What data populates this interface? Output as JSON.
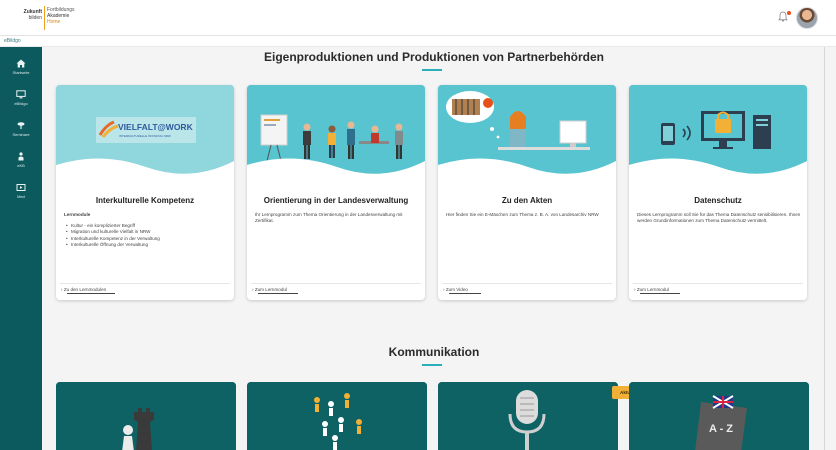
{
  "header": {
    "logo_line1": "Zukunft",
    "logo_line2": "bilden",
    "brand_line1": "Fortbildungs",
    "brand_line2": "Akademie",
    "brand_line3": "Home",
    "substrip_text": "eBildgo"
  },
  "sidebar": {
    "items": [
      {
        "label": "Startseite",
        "icon": "home-icon"
      },
      {
        "label": "eBildgo",
        "icon": "monitor-icon"
      },
      {
        "label": "Seminare",
        "icon": "presentation-icon"
      },
      {
        "label": "eKB",
        "icon": "person-icon"
      },
      {
        "label": "Med",
        "icon": "media-icon"
      }
    ]
  },
  "sections": {
    "eigen_title": "Eigenproduktionen und Produktionen von Partnerbehörden",
    "kommunikation_title": "Kommunikation"
  },
  "cards": [
    {
      "title": "Interkulturelle Kompetenz",
      "image_text": "VIELFALT@WORK",
      "image_subtext": "INTERKULTURELLE ÖFFNUNG NRW",
      "heading": "Lernmodule",
      "bullets": [
        "Kultur - ein komplizierter Begriff",
        "Migration und kulturelle Vielfalt in NRW",
        "Interkulturelle Kompetenz in der Verwaltung",
        "Interkulturelle Öffnung der Verwaltung"
      ],
      "link": "Zu den Lernmodulen"
    },
    {
      "title": "Orientierung in der Landesverwaltung",
      "desc": "Ihr Lernprogramm zum Thema Orientierung in der Landesverwaltung mit Zertifikat.",
      "link": "Zum Lernmodul"
    },
    {
      "title": "Zu den Akten",
      "desc": "Hier finden Sie ein E-Mäxchen zum Thema z. B. A. von Landesarchiv NRW",
      "link": "Zum Video"
    },
    {
      "title": "Datenschutz",
      "desc": "Dieses Lernprogramm soll Sie für das Thema Datenschutz sensibilisieren. Ihnen werden Grundinformationen zum Thema Datenschutz vermittelt.",
      "link": "Zum Lernmodul"
    }
  ],
  "kommunikation": {
    "badge": "Aktualisierung",
    "book_text": "A - Z"
  },
  "colors": {
    "sidebar": "#0d5a5e",
    "card_image": "#57c4cf",
    "accent": "#2aaeb8",
    "kcard": "#0e6264",
    "badge": "#f2b036"
  }
}
